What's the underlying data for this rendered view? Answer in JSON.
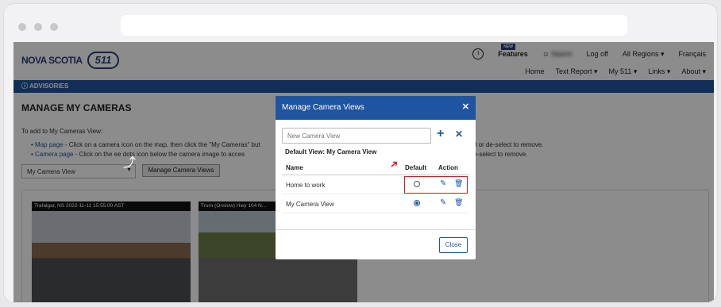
{
  "site": {
    "logo_text": "NOVA SCOTIA",
    "logo_badge": "511",
    "nav_top": [
      "Features",
      "Log off",
      "All Regions",
      "Français"
    ],
    "new_badge": "NEW",
    "user_name": "Naomi",
    "nav_sub": [
      "Home",
      "Text Report",
      "My 511",
      "Links",
      "About"
    ],
    "advisories": "ADVISORIES",
    "page_title": "MANAGE MY CAMERAS",
    "intro": "To add to My Cameras View:",
    "bullet1_link": "Map page",
    "bullet1_text": " - Click on a camera icon on the map, then click the \"My Cameras\" but",
    "bullet2_link": "Camera page",
    "bullet2_text": " - Click on the     ee dots icon below the camera image to acces",
    "bullet1_right": "add or de-select to remove.",
    "bullet2_right": "r de-select to remove.",
    "view_select_value": "My Camera View",
    "manage_button": "Manage Camera Views",
    "cam1_caption": "Trafalgar, NS 2022-11-11 15:55:00 AST",
    "cam2_caption": "Truro (Onslow) Hwy 104 N..."
  },
  "modal": {
    "title": "Manage Camera Views",
    "new_view_placeholder": "New Camera View",
    "default_view_label": "Default View: My Camera View",
    "col_name": "Name",
    "col_default": "Default",
    "col_action": "Action",
    "rows": [
      {
        "name": "Home to work",
        "default": false
      },
      {
        "name": "My Camera View",
        "default": true
      }
    ],
    "close_button": "Close"
  },
  "colors": {
    "brand": "#1f55a0",
    "highlight": "#cc2222"
  }
}
